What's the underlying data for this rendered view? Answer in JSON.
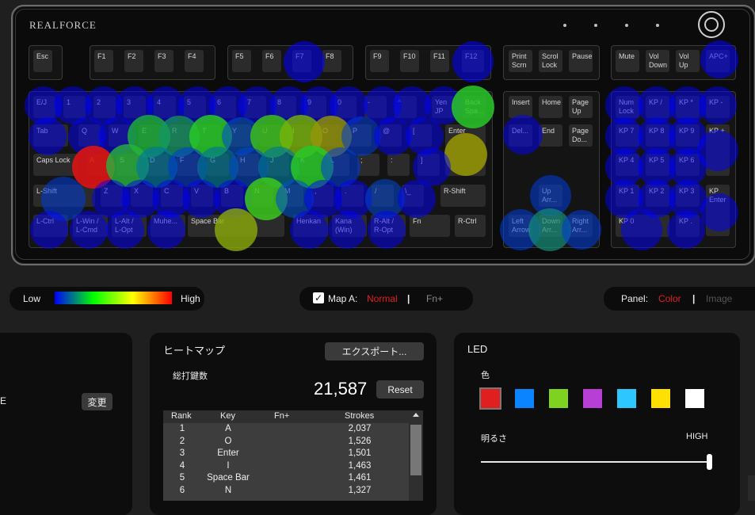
{
  "brand": "REALFORCE",
  "colors": {
    "accent_red": "#e02020",
    "heat_high": "#ff0000",
    "heat_low": "#0000ff"
  },
  "keys": [
    {
      "id": "esc",
      "label": "Esc"
    },
    {
      "id": "f1",
      "label": "F1"
    },
    {
      "id": "f2",
      "label": "F2"
    },
    {
      "id": "f3",
      "label": "F3"
    },
    {
      "id": "f4",
      "label": "F4"
    },
    {
      "id": "f5",
      "label": "F5"
    },
    {
      "id": "f6",
      "label": "F6"
    },
    {
      "id": "f7",
      "label": "F7"
    },
    {
      "id": "f8",
      "label": "F8"
    },
    {
      "id": "f9",
      "label": "F9"
    },
    {
      "id": "f10",
      "label": "F10"
    },
    {
      "id": "f11",
      "label": "F11"
    },
    {
      "id": "f12",
      "label": "F12"
    },
    {
      "id": "prtsc",
      "label": "Print\nScrn"
    },
    {
      "id": "scrlk",
      "label": "Scrol\nLock"
    },
    {
      "id": "pause",
      "label": "Pause"
    },
    {
      "id": "mute",
      "label": "Mute"
    },
    {
      "id": "voldn",
      "label": "Vol\nDown"
    },
    {
      "id": "volup",
      "label": "Vol\nUp"
    },
    {
      "id": "apc",
      "label": "APC+"
    },
    {
      "id": "ej",
      "label": "E/J"
    },
    {
      "id": "n1",
      "label": "1"
    },
    {
      "id": "n2",
      "label": "2"
    },
    {
      "id": "n3",
      "label": "3"
    },
    {
      "id": "n4",
      "label": "4"
    },
    {
      "id": "n5",
      "label": "5"
    },
    {
      "id": "n6",
      "label": "6"
    },
    {
      "id": "n7",
      "label": "7"
    },
    {
      "id": "n8",
      "label": "8"
    },
    {
      "id": "n9",
      "label": "9"
    },
    {
      "id": "n0",
      "label": "0"
    },
    {
      "id": "minus",
      "label": "-"
    },
    {
      "id": "caret",
      "label": "^"
    },
    {
      "id": "yen",
      "label": "Yen\nJP"
    },
    {
      "id": "bksp",
      "label": "Back\nSpa..."
    },
    {
      "id": "ins",
      "label": "Insert"
    },
    {
      "id": "home",
      "label": "Home"
    },
    {
      "id": "pgup",
      "label": "Page\nUp"
    },
    {
      "id": "numlk",
      "label": "Num\nLock"
    },
    {
      "id": "kpdiv",
      "label": "KP /"
    },
    {
      "id": "kpmul",
      "label": "KP *"
    },
    {
      "id": "kpsub",
      "label": "KP -"
    },
    {
      "id": "tab",
      "label": "Tab"
    },
    {
      "id": "q",
      "label": "Q"
    },
    {
      "id": "w",
      "label": "W"
    },
    {
      "id": "e",
      "label": "E"
    },
    {
      "id": "r",
      "label": "R"
    },
    {
      "id": "t",
      "label": "T"
    },
    {
      "id": "y",
      "label": "Y"
    },
    {
      "id": "u",
      "label": "U"
    },
    {
      "id": "i",
      "label": "I"
    },
    {
      "id": "o",
      "label": "O"
    },
    {
      "id": "p",
      "label": "P"
    },
    {
      "id": "at",
      "label": "@"
    },
    {
      "id": "lbr",
      "label": "["
    },
    {
      "id": "enter",
      "label": "Enter"
    },
    {
      "id": "del",
      "label": "Del..."
    },
    {
      "id": "end",
      "label": "End"
    },
    {
      "id": "pgdn",
      "label": "Page\nDo..."
    },
    {
      "id": "kp7",
      "label": "KP 7"
    },
    {
      "id": "kp8",
      "label": "KP 8"
    },
    {
      "id": "kp9",
      "label": "KP 9"
    },
    {
      "id": "kpadd",
      "label": "KP +"
    },
    {
      "id": "caps",
      "label": "Caps Lock"
    },
    {
      "id": "a",
      "label": "A"
    },
    {
      "id": "s",
      "label": "S"
    },
    {
      "id": "d",
      "label": "D"
    },
    {
      "id": "f",
      "label": "F"
    },
    {
      "id": "g",
      "label": "G"
    },
    {
      "id": "h",
      "label": "H"
    },
    {
      "id": "j",
      "label": "J"
    },
    {
      "id": "k",
      "label": "K"
    },
    {
      "id": "l",
      "label": "L"
    },
    {
      "id": "semi",
      "label": ";"
    },
    {
      "id": "colon",
      "label": ":"
    },
    {
      "id": "rbr",
      "label": "]"
    },
    {
      "id": "kp4",
      "label": "KP 4"
    },
    {
      "id": "kp5",
      "label": "KP 5"
    },
    {
      "id": "kp6",
      "label": "KP 6"
    },
    {
      "id": "lshift",
      "label": "L-Shift"
    },
    {
      "id": "z",
      "label": "Z"
    },
    {
      "id": "x",
      "label": "X"
    },
    {
      "id": "c",
      "label": "C"
    },
    {
      "id": "v",
      "label": "V"
    },
    {
      "id": "b",
      "label": "B"
    },
    {
      "id": "n",
      "label": "N"
    },
    {
      "id": "m",
      "label": "M"
    },
    {
      "id": "comma",
      "label": ","
    },
    {
      "id": "dot",
      "label": "."
    },
    {
      "id": "slash",
      "label": "/"
    },
    {
      "id": "bslash",
      "label": "\\_"
    },
    {
      "id": "rshift",
      "label": "R-Shift"
    },
    {
      "id": "up",
      "label": "Up\nArr..."
    },
    {
      "id": "kp1",
      "label": "KP 1"
    },
    {
      "id": "kp2",
      "label": "KP 2"
    },
    {
      "id": "kp3",
      "label": "KP 3"
    },
    {
      "id": "kpenter",
      "label": "KP\nEnter"
    },
    {
      "id": "lctrl",
      "label": "L-Ctrl"
    },
    {
      "id": "lwin",
      "label": "L-Win /\nL-Cmd"
    },
    {
      "id": "lalt",
      "label": "L-Alt /\nL-Opt"
    },
    {
      "id": "muhe",
      "label": "Muhe..."
    },
    {
      "id": "space",
      "label": "Space Bar"
    },
    {
      "id": "henkan",
      "label": "Henkan"
    },
    {
      "id": "kana",
      "label": "Kana\n(Win)"
    },
    {
      "id": "ralt",
      "label": "R-Alt /\nR-Opt"
    },
    {
      "id": "fn",
      "label": "Fn"
    },
    {
      "id": "rctrl",
      "label": "R-Ctrl"
    },
    {
      "id": "left",
      "label": "Left\nArrow"
    },
    {
      "id": "down",
      "label": "Down\nArr..."
    },
    {
      "id": "right",
      "label": "Right\nArr..."
    },
    {
      "id": "kp0",
      "label": "KP 0"
    },
    {
      "id": "kpdot",
      "label": "KP ."
    }
  ],
  "legend": {
    "low": "Low",
    "high": "High"
  },
  "map": {
    "label": "Map A:",
    "normal": "Normal",
    "sep": "|",
    "fn": "Fn+",
    "checked": true
  },
  "panel": {
    "label": "Panel:",
    "color": "Color",
    "sep": "|",
    "image": "Image"
  },
  "left_card": {
    "partial_text": "E",
    "change_button": "変更"
  },
  "heatmap": {
    "title": "ヒートマップ",
    "export_button": "エクスポート...",
    "total_label": "総打鍵数",
    "total_value": "21,587",
    "reset_button": "Reset",
    "columns": [
      "Rank",
      "Key",
      "Fn+",
      "Strokes"
    ],
    "rows": [
      {
        "rank": "1",
        "key": "A",
        "fn": "",
        "strokes": "2,037"
      },
      {
        "rank": "2",
        "key": "O",
        "fn": "",
        "strokes": "1,526"
      },
      {
        "rank": "3",
        "key": "Enter",
        "fn": "",
        "strokes": "1,501"
      },
      {
        "rank": "4",
        "key": "I",
        "fn": "",
        "strokes": "1,463"
      },
      {
        "rank": "5",
        "key": "Space Bar",
        "fn": "",
        "strokes": "1,461"
      },
      {
        "rank": "6",
        "key": "N",
        "fn": "",
        "strokes": "1,327"
      }
    ]
  },
  "led": {
    "title": "LED",
    "color_label": "色",
    "swatches": [
      "#e02020",
      "#0a84ff",
      "#7ed321",
      "#b83fd6",
      "#2ec6ff",
      "#ffe000",
      "#ffffff"
    ],
    "brightness_label": "明るさ",
    "brightness_value": "HIGH",
    "brightness_level": 1.0
  }
}
